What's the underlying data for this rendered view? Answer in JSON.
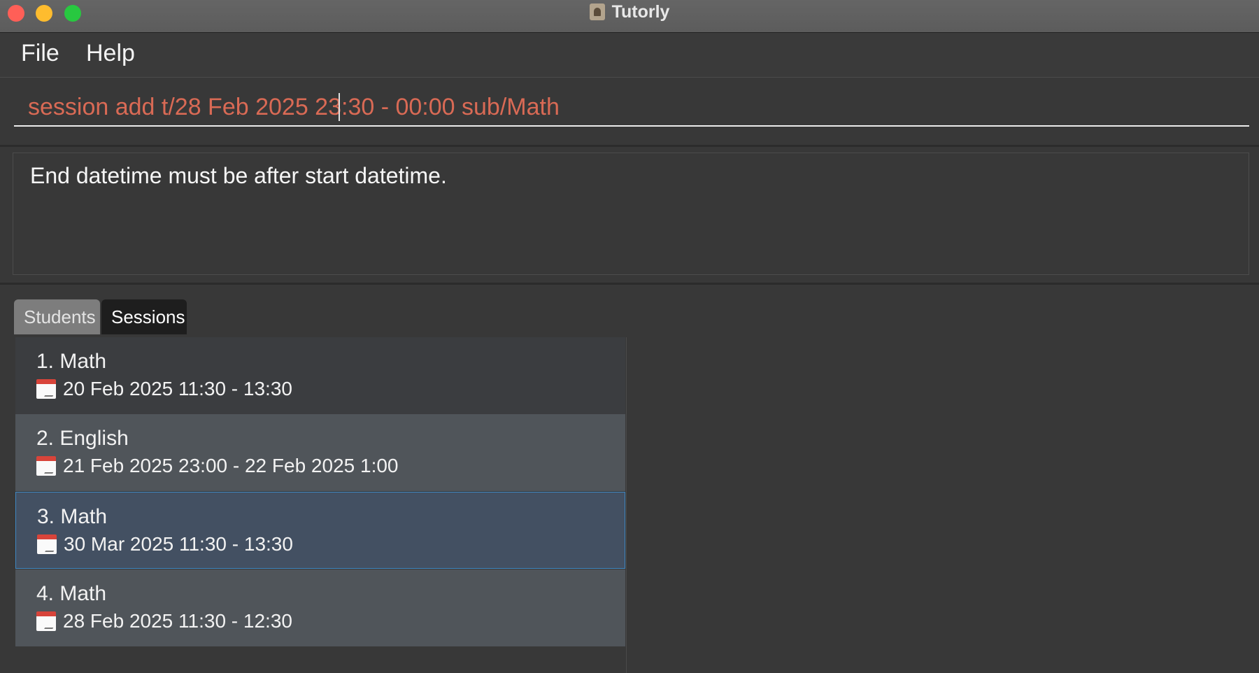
{
  "window": {
    "title": "Tutorly"
  },
  "menu": {
    "items": [
      "File",
      "Help"
    ]
  },
  "command": {
    "value": "session add t/28 Feb 2025 23:30 - 00:00 sub/Math"
  },
  "result": {
    "message": "End datetime must be after start datetime."
  },
  "tabs": [
    {
      "label": "Students",
      "active": false
    },
    {
      "label": "Sessions",
      "active": true
    }
  ],
  "sessions": [
    {
      "title": "1. Math",
      "datetime": "20 Feb 2025 11:30 - 13:30",
      "icon": "calendar-icon"
    },
    {
      "title": "2. English",
      "datetime": "21 Feb 2025 23:00 - 22 Feb 2025 1:00",
      "icon": "calendar-icon"
    },
    {
      "title": "3. Math",
      "datetime": "30 Mar 2025 11:30 - 13:30",
      "icon": "calendar-icon",
      "selected": true
    },
    {
      "title": "4. Math",
      "datetime": "28 Feb 2025 11:30 - 12:30",
      "icon": "calendar-icon"
    }
  ],
  "colors": {
    "error_text": "#d96a55",
    "selection_border": "#3f87c2",
    "close": "#ff5f57",
    "minimize": "#febc2e",
    "maximize": "#28c840"
  }
}
